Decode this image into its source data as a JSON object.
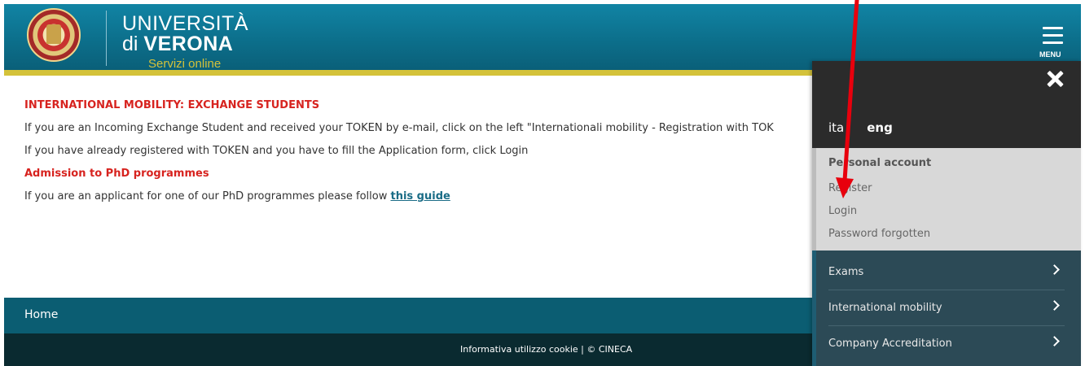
{
  "header": {
    "brand_line1": "UNIVERSITÀ",
    "brand_line2_prefix": "di ",
    "brand_line2_bold": "VERONA",
    "brand_line3": "Servizi online",
    "menu_label": "MENU"
  },
  "content": {
    "heading1": "INTERNATIONAL MOBILITY: EXCHANGE STUDENTS",
    "para1": "If you are an Incoming Exchange Student and received your TOKEN by e-mail, click on the left \"Internationali mobility - Registration with TOK",
    "para2": "If you have already registered with TOKEN and you have to fill the Application form, click Login",
    "heading2": "Admission to PhD programmes",
    "para3_prefix": "If you are an applicant for one of our PhD programmes please follow ",
    "para3_link": "this guide"
  },
  "footer": {
    "home": "Home",
    "bottom_text": "Informativa utilizzo cookie | © CINECA"
  },
  "side_menu": {
    "lang_ita": "ita",
    "lang_eng": "eng",
    "account_title": "Personal account",
    "account_items": [
      "Register",
      "Login",
      "Password forgotten"
    ],
    "nav_items": [
      "Exams",
      "International mobility",
      "Company Accreditation"
    ]
  },
  "colors": {
    "header_teal": "#0c6e8a",
    "accent_gold": "#d4c23a",
    "heading_red": "#d7231f",
    "link_teal": "#1a6c86",
    "annotation_red": "#e8000d"
  }
}
